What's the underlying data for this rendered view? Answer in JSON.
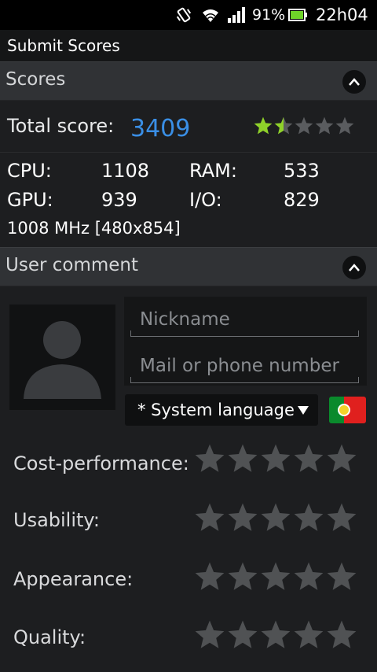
{
  "status_bar": {
    "battery_percent": "91%",
    "time": "22h04",
    "icons": [
      "vibrate-icon",
      "wifi-icon",
      "signal-icon",
      "battery-icon"
    ]
  },
  "title_bar": {
    "title": "Submit Scores"
  },
  "scores_section": {
    "header": "Scores",
    "total_label": "Total score:",
    "total_value": "3409",
    "total_rating": 1.5,
    "rating_max": 5,
    "cpu_label": "CPU:",
    "cpu_value": "1108",
    "ram_label": "RAM:",
    "ram_value": "533",
    "gpu_label": "GPU:",
    "gpu_value": "939",
    "io_label": "I/O:",
    "io_value": "829",
    "device_info": "1008 MHz [480x854]"
  },
  "comment_section": {
    "header": "User comment",
    "nickname_placeholder": "Nickname",
    "contact_placeholder": "Mail or phone number",
    "language_value": "* System language",
    "flag": "portugal-flag-icon",
    "ratings": [
      {
        "label": "Cost-performance:",
        "value": 0
      },
      {
        "label": "Usability:",
        "value": 0
      },
      {
        "label": "Appearance:",
        "value": 0
      },
      {
        "label": "Quality:",
        "value": 0
      }
    ]
  },
  "colors": {
    "accent_blue": "#3a8fe6",
    "star_green": "#8fd12a",
    "star_empty": "#5a5c5f",
    "rating_star": "#505254",
    "background": "#1d1e20"
  }
}
